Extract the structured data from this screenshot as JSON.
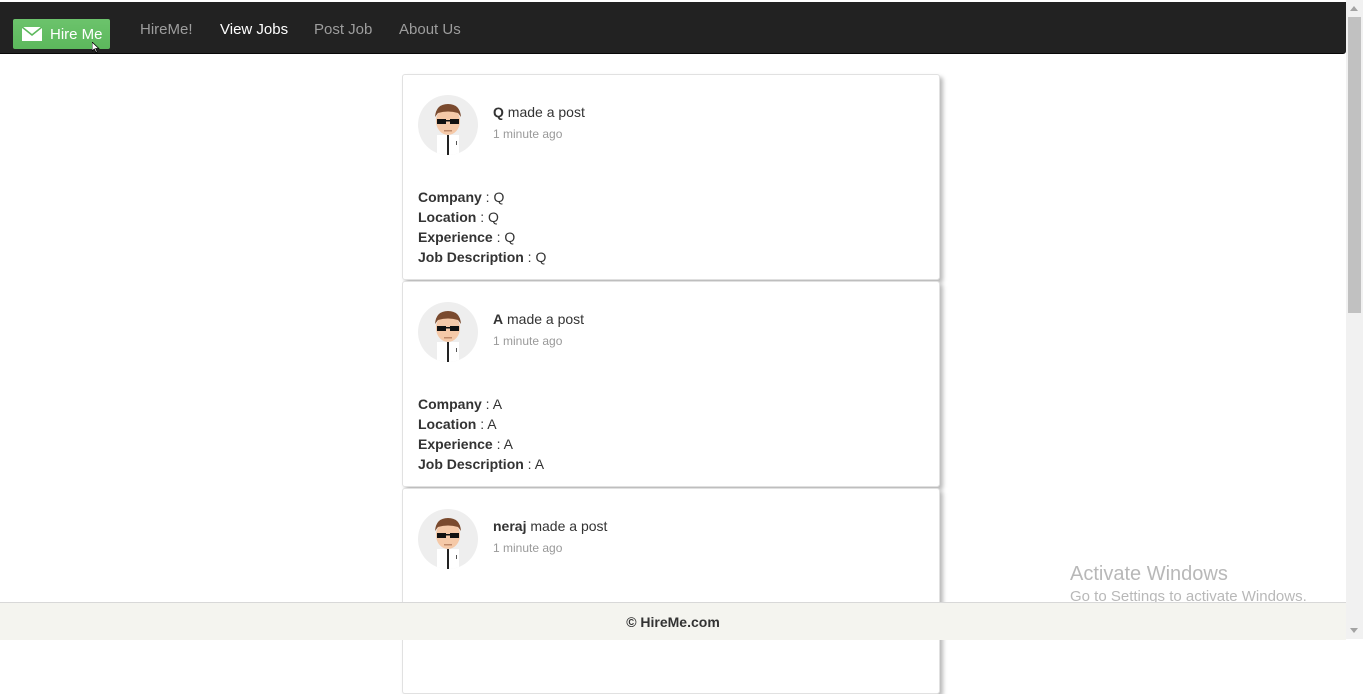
{
  "navbar": {
    "brand_label": "Hire Me",
    "links": [
      {
        "label": "HireMe!"
      },
      {
        "label": "View Jobs"
      },
      {
        "label": "Post Job"
      },
      {
        "label": "About Us"
      }
    ]
  },
  "posts": [
    {
      "author": "Q",
      "action": "made a post",
      "time": "1 minute ago",
      "fields": [
        {
          "label": "Company",
          "value": "Q"
        },
        {
          "label": "Location",
          "value": "Q"
        },
        {
          "label": "Experience",
          "value": "Q"
        },
        {
          "label": "Job Description",
          "value": "Q"
        }
      ]
    },
    {
      "author": "A",
      "action": "made a post",
      "time": "1 minute ago",
      "fields": [
        {
          "label": "Company",
          "value": "A"
        },
        {
          "label": "Location",
          "value": "A"
        },
        {
          "label": "Experience",
          "value": "A"
        },
        {
          "label": "Job Description",
          "value": "A"
        }
      ]
    },
    {
      "author": "neraj",
      "action": "made a post",
      "time": "1 minute ago"
    }
  ],
  "watermark": {
    "line1": "Activate Windows",
    "line2": "Go to Settings to activate Windows."
  },
  "footer": {
    "text": "© HireMe.com"
  },
  "colors": {
    "navbar": "#222222",
    "brand": "#5cb85c",
    "footer": "#f4f4ef"
  }
}
